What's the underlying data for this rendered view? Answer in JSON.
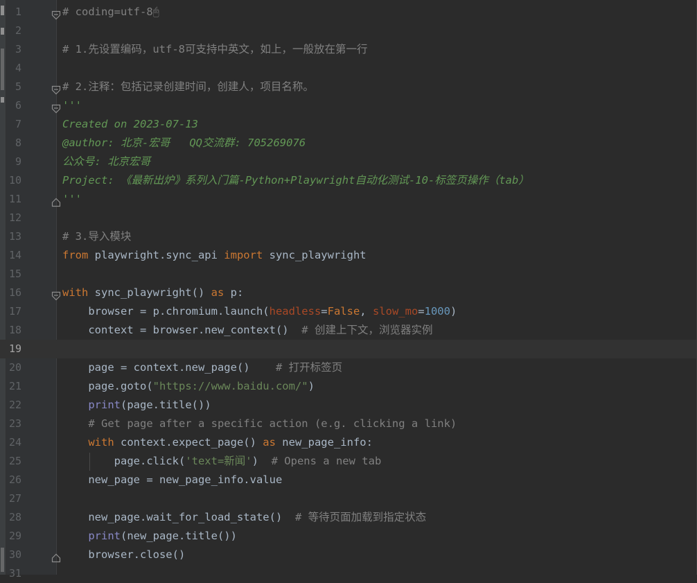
{
  "lines": [
    {
      "num": "1",
      "fold": "open",
      "tokens": [
        {
          "t": "# coding=utf-8",
          "c": "c"
        },
        {
          "t": "🖰",
          "c": "c"
        }
      ]
    },
    {
      "num": "2",
      "tokens": []
    },
    {
      "num": "3",
      "tokens": [
        {
          "t": "# 1.先设置编码，utf-8可支持中英文，如上，一般放在第一行",
          "c": "c"
        }
      ]
    },
    {
      "num": "4",
      "tokens": []
    },
    {
      "num": "5",
      "fold": "open",
      "tokens": [
        {
          "t": "# 2.注释：包括记录创建时间，创建人，项目名称。",
          "c": "c"
        }
      ]
    },
    {
      "num": "6",
      "fold": "open",
      "tokens": [
        {
          "t": "'''",
          "c": "doc"
        }
      ]
    },
    {
      "num": "7",
      "tokens": [
        {
          "t": "Created on 2023-07-13",
          "c": "doc"
        }
      ]
    },
    {
      "num": "8",
      "tokens": [
        {
          "t": "@author: 北京-宏哥   QQ交流群: 705269076",
          "c": "doc"
        }
      ]
    },
    {
      "num": "9",
      "tokens": [
        {
          "t": "公众号: 北京宏哥",
          "c": "doc"
        }
      ]
    },
    {
      "num": "10",
      "tokens": [
        {
          "t": "Project: 《最新出炉》系列入门篇-Python+Playwright自动化测试-10-标签页操作（tab）",
          "c": "doc"
        }
      ]
    },
    {
      "num": "11",
      "fold": "close",
      "tokens": [
        {
          "t": "'''",
          "c": "doc"
        }
      ]
    },
    {
      "num": "12",
      "tokens": []
    },
    {
      "num": "13",
      "tokens": [
        {
          "t": "# 3.导入模块",
          "c": "c"
        }
      ]
    },
    {
      "num": "14",
      "tokens": [
        {
          "t": "from",
          "c": "k"
        },
        {
          "t": " playwright.sync_api "
        },
        {
          "t": "import",
          "c": "k"
        },
        {
          "t": " sync_playwright"
        }
      ]
    },
    {
      "num": "15",
      "tokens": []
    },
    {
      "num": "16",
      "fold": "open",
      "tokens": [
        {
          "t": "with",
          "c": "k"
        },
        {
          "t": " sync_playwright() "
        },
        {
          "t": "as",
          "c": "k"
        },
        {
          "t": " p:"
        }
      ]
    },
    {
      "num": "17",
      "tokens": [
        {
          "t": "    browser = p.chromium.launch("
        },
        {
          "t": "headless",
          "c": "kw"
        },
        {
          "t": "="
        },
        {
          "t": "False",
          "c": "k"
        },
        {
          "t": ", "
        },
        {
          "t": "slow_mo",
          "c": "kw"
        },
        {
          "t": "="
        },
        {
          "t": "1000",
          "c": "n"
        },
        {
          "t": ")"
        }
      ]
    },
    {
      "num": "18",
      "tokens": [
        {
          "t": "    context = browser.new_context()  "
        },
        {
          "t": "# 创建上下文，浏览器实例",
          "c": "c"
        }
      ]
    },
    {
      "num": "19",
      "current": true,
      "tokens": []
    },
    {
      "num": "20",
      "tokens": [
        {
          "t": "    page = context.new_page()    "
        },
        {
          "t": "# 打开标签页",
          "c": "c"
        }
      ]
    },
    {
      "num": "21",
      "tokens": [
        {
          "t": "    page.goto("
        },
        {
          "t": "\"https://www.baidu.com/\"",
          "c": "s"
        },
        {
          "t": ")"
        }
      ]
    },
    {
      "num": "22",
      "tokens": [
        {
          "t": "    "
        },
        {
          "t": "print",
          "c": "b"
        },
        {
          "t": "(page.title())"
        }
      ]
    },
    {
      "num": "23",
      "tokens": [
        {
          "t": "    # Get page after a specific action (e.g. clicking a link)",
          "c": "c"
        }
      ]
    },
    {
      "num": "24",
      "tokens": [
        {
          "t": "    "
        },
        {
          "t": "with",
          "c": "k"
        },
        {
          "t": " context.expect_page() "
        },
        {
          "t": "as",
          "c": "k"
        },
        {
          "t": " new_page_info:"
        }
      ]
    },
    {
      "num": "25",
      "tokens": [
        {
          "t": "        page.click("
        },
        {
          "t": "'text=新闻'",
          "c": "s"
        },
        {
          "t": ")  "
        },
        {
          "t": "# Opens a new tab",
          "c": "c"
        }
      ]
    },
    {
      "num": "26",
      "tokens": [
        {
          "t": "    new_page = new_page_info.value"
        }
      ]
    },
    {
      "num": "27",
      "tokens": []
    },
    {
      "num": "28",
      "tokens": [
        {
          "t": "    new_page.wait_for_load_state()  "
        },
        {
          "t": "# 等待页面加载到指定状态",
          "c": "c"
        }
      ]
    },
    {
      "num": "29",
      "tokens": [
        {
          "t": "    "
        },
        {
          "t": "print",
          "c": "b"
        },
        {
          "t": "(new_page.title())"
        }
      ]
    },
    {
      "num": "30",
      "fold": "close",
      "tokens": [
        {
          "t": "    browser.close()"
        }
      ]
    },
    {
      "num": "31",
      "tokens": []
    }
  ]
}
